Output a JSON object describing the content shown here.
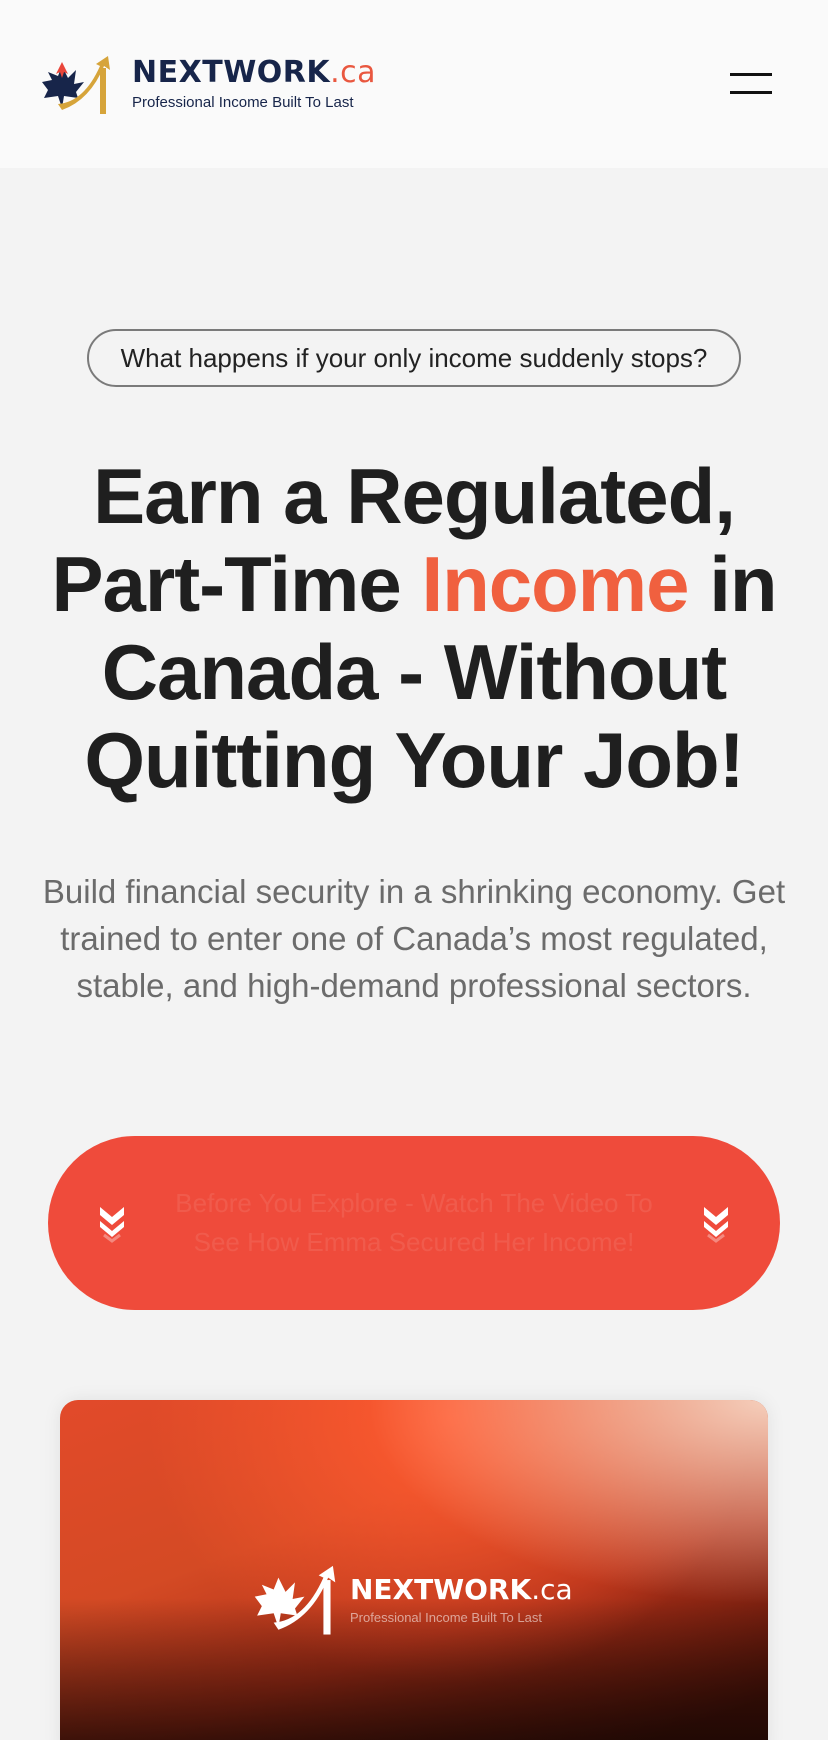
{
  "header": {
    "brand_name": "NEXTWORK",
    "brand_tld": ".ca",
    "tagline": "Professional Income Built To Last"
  },
  "hero": {
    "pill_text": "What happens if your only income suddenly stops?",
    "headline_line1": "Earn a Regulated,",
    "headline_line2_pre": "Part-Time ",
    "headline_accent": "Income",
    "headline_line2_post": " in",
    "headline_line3": "Canada - Without",
    "headline_line4": "Quitting Your Job!",
    "subtext": "Build financial security in a shrinking economy. Get trained to enter one of Canada’s most regulated, stable, and high-demand professional sectors.",
    "cta_text": "Before You Explore - Watch The Video To See How Emma Secured Her Income!"
  },
  "video": {
    "brand_name": "NEXTWORK",
    "brand_tld": ".ca",
    "tagline": "Professional Income Built To Last"
  },
  "colors": {
    "accent": "#f0603f",
    "cta_bg": "#ef4b3b",
    "brand_navy": "#17254a",
    "brand_gold": "#d6a43a"
  }
}
